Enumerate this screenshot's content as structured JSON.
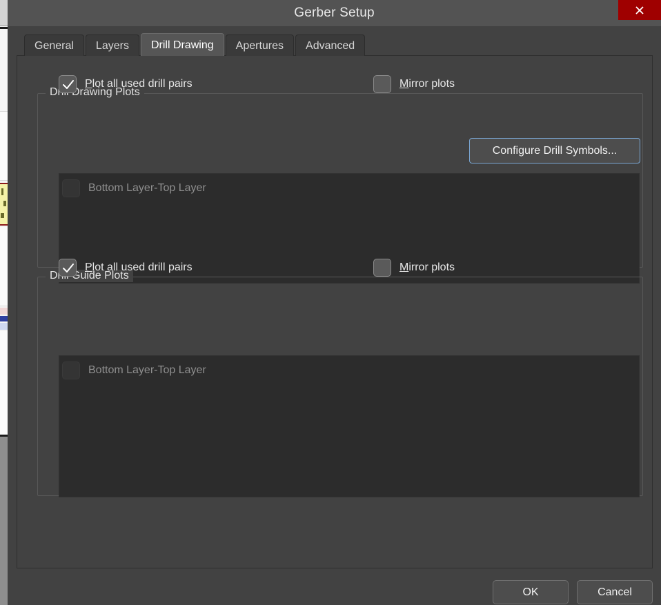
{
  "window": {
    "title": "Gerber Setup",
    "close_icon": "close-icon",
    "close_button_color": "#9f0000",
    "titlebar_color": "#535353",
    "body_color": "#424242"
  },
  "tabs": [
    {
      "label": "General",
      "active": false
    },
    {
      "label": "Layers",
      "active": false
    },
    {
      "label": "Drill Drawing",
      "active": true
    },
    {
      "label": "Apertures",
      "active": false
    },
    {
      "label": "Advanced",
      "active": false
    }
  ],
  "drill_drawing_plots": {
    "legend": "Drill Drawing Plots",
    "plot_all": {
      "accel": "P",
      "rest": "lot all used drill pairs",
      "checked": true,
      "enabled": true
    },
    "mirror": {
      "accel": "M",
      "rest": "irror plots",
      "checked": false,
      "enabled": true
    },
    "configure_button": {
      "label": "Configure Drill Symbols...",
      "focused": true,
      "focus_color": "#7aa7d4"
    },
    "list_items": [
      {
        "label": "Bottom Layer-Top Layer",
        "checked": false,
        "enabled": false
      }
    ]
  },
  "drill_guide_plots": {
    "legend": "Drill Guide Plots",
    "plot_all": {
      "accel": "P",
      "rest": "lot all used drill pairs",
      "checked": true,
      "enabled": true
    },
    "mirror": {
      "accel": "M",
      "rest": "irror plots",
      "checked": false,
      "enabled": true
    },
    "list_items": [
      {
        "label": "Bottom Layer-Top Layer",
        "checked": false,
        "enabled": false
      }
    ]
  },
  "footer": {
    "ok_label": "OK",
    "cancel_label": "Cancel"
  }
}
